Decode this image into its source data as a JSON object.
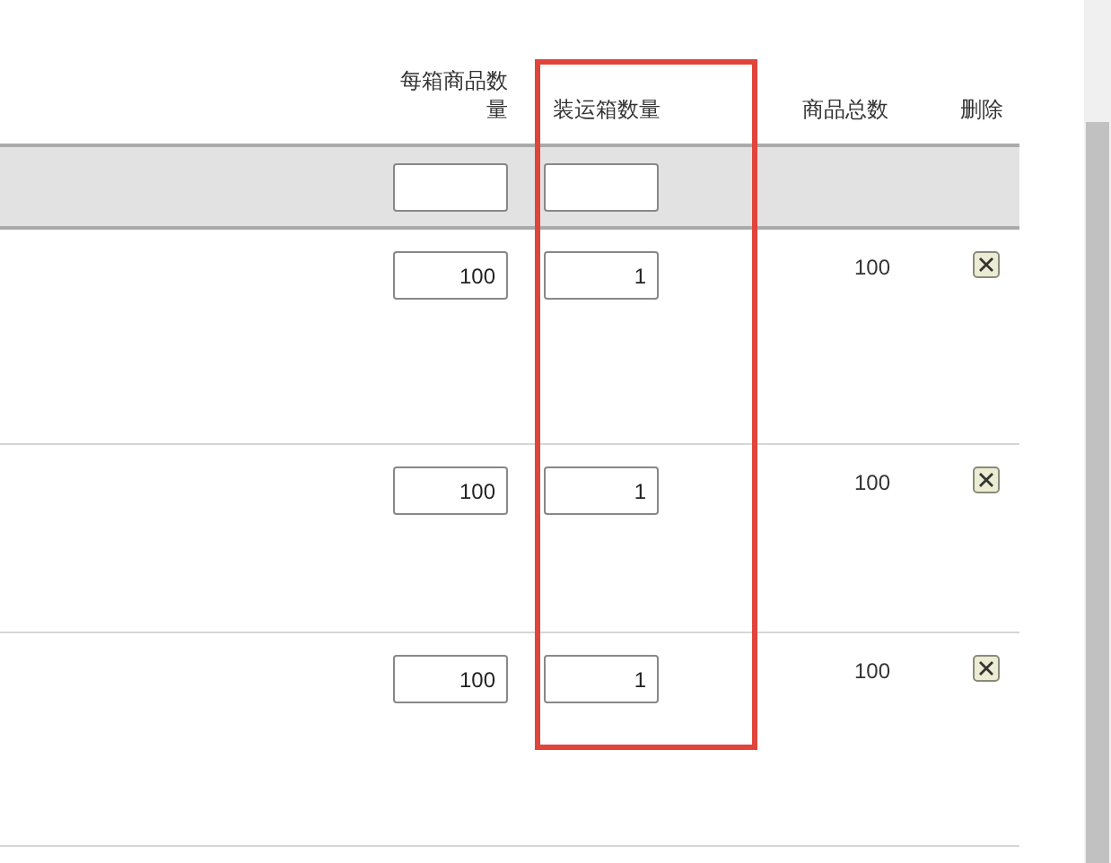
{
  "table": {
    "columns": [
      {
        "label": "每箱商品数量",
        "highlighted": false
      },
      {
        "label": "装运箱数量",
        "highlighted": true
      },
      {
        "label": "商品总数",
        "highlighted": false
      },
      {
        "label": "删除",
        "highlighted": false
      }
    ],
    "rows": [
      {
        "units_per_box": "100",
        "box_count": "1",
        "total": "100"
      },
      {
        "units_per_box": "100",
        "box_count": "1",
        "total": "100"
      },
      {
        "units_per_box": "100",
        "box_count": "1",
        "total": "100"
      }
    ]
  }
}
